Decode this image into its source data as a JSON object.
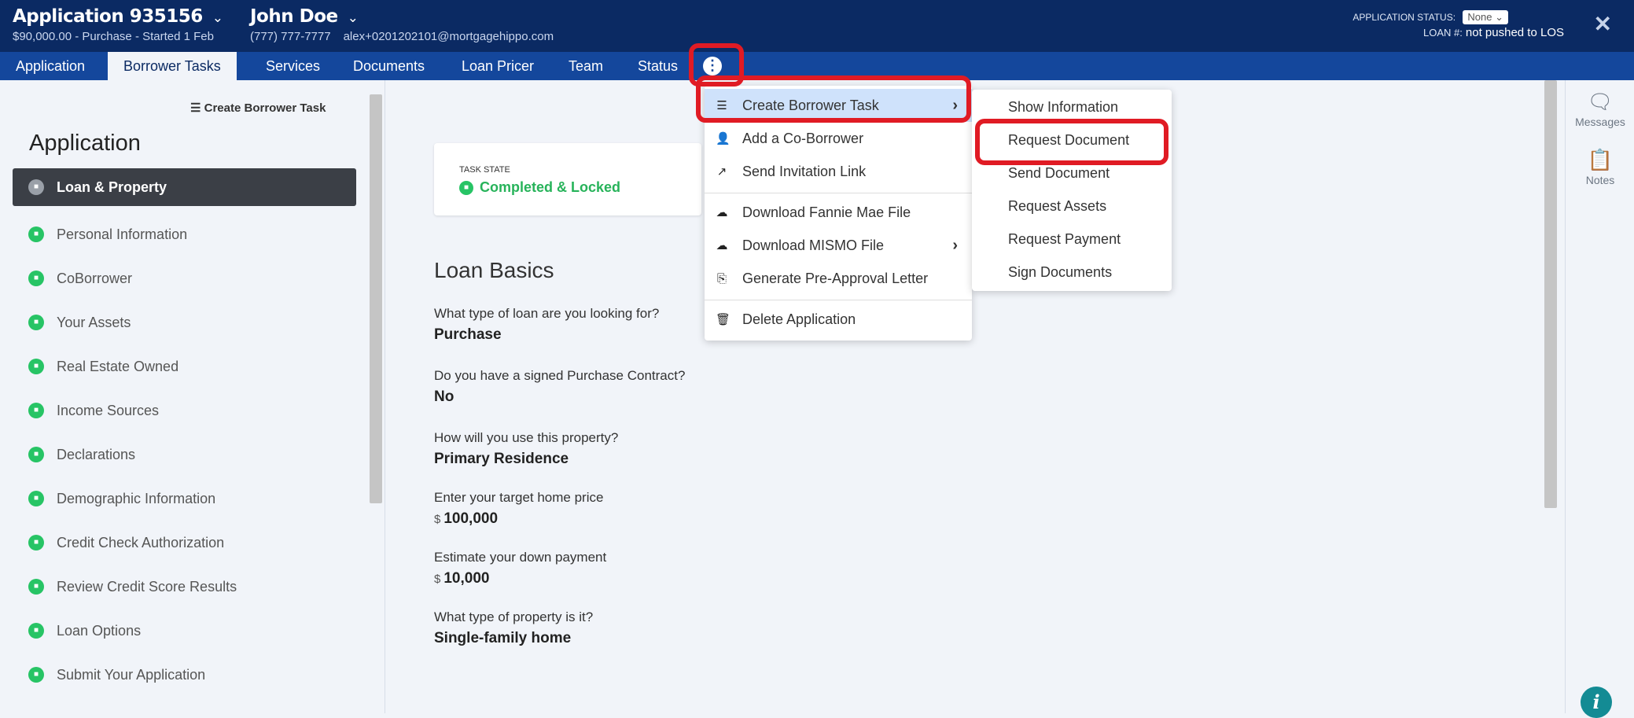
{
  "header": {
    "app_title": "Application 935156",
    "app_subtitle": "$90,000.00 - Purchase - Started 1 Feb",
    "person_name": "John Doe",
    "person_phone": "(777) 777-7777",
    "person_email": "alex+0201202101@mortgagehippo.com",
    "status_label": "APPLICATION STATUS:",
    "status_value": "None",
    "loan_label": "LOAN #:",
    "loan_value": "not pushed to LOS",
    "close_symbol": "✕",
    "chevron": "⌄"
  },
  "tabs": [
    {
      "label": "Application"
    },
    {
      "label": "Borrower Tasks"
    },
    {
      "label": "Services"
    },
    {
      "label": "Documents"
    },
    {
      "label": "Loan Pricer"
    },
    {
      "label": "Team"
    },
    {
      "label": "Status"
    }
  ],
  "more_button": "⋮",
  "sidebar": {
    "create_task_label": "Create Borrower Task",
    "title": "Application",
    "items": [
      {
        "label": "Loan & Property"
      },
      {
        "label": "Personal Information"
      },
      {
        "label": "CoBorrower"
      },
      {
        "label": "Your Assets"
      },
      {
        "label": "Real Estate Owned"
      },
      {
        "label": "Income Sources"
      },
      {
        "label": "Declarations"
      },
      {
        "label": "Demographic Information"
      },
      {
        "label": "Credit Check Authorization"
      },
      {
        "label": "Review Credit Score Results"
      },
      {
        "label": "Loan Options"
      },
      {
        "label": "Submit Your Application"
      }
    ]
  },
  "main": {
    "task_state_label": "TASK STATE",
    "task_state_value": "Completed & Locked",
    "section_title": "Loan Basics",
    "questions": [
      {
        "q": "What type of loan are you looking for?",
        "a": "Purchase",
        "currency": ""
      },
      {
        "q": "Do you have a signed Purchase Contract?",
        "a": "No",
        "currency": ""
      },
      {
        "q": "How will you use this property?",
        "a": "Primary Residence",
        "currency": ""
      },
      {
        "q": "Enter your target home price",
        "a": "100,000",
        "currency": "$"
      },
      {
        "q": "Estimate your down payment",
        "a": "10,000",
        "currency": "$"
      },
      {
        "q": "What type of property is it?",
        "a": "Single-family home",
        "currency": ""
      }
    ]
  },
  "right_panel": {
    "messages_label": "Messages",
    "notes_label": "Notes",
    "info_label": "i"
  },
  "menu": {
    "items": [
      {
        "label": "Create Borrower Task",
        "icon": "list-add-icon",
        "has_submenu": true
      },
      {
        "label": "Add a Co-Borrower",
        "icon": "add-user-icon"
      },
      {
        "label": "Send Invitation Link",
        "icon": "share-icon"
      },
      {
        "label": "Download Fannie Mae File",
        "icon": "cloud-download-icon"
      },
      {
        "label": "Download MISMO File",
        "icon": "cloud-download-icon",
        "has_submenu": true
      },
      {
        "label": "Generate Pre-Approval Letter",
        "icon": "document-export-icon"
      },
      {
        "label": "Delete Application",
        "icon": "trash-icon"
      }
    ],
    "submenu": [
      {
        "label": "Show Information"
      },
      {
        "label": "Request Document"
      },
      {
        "label": "Send Document"
      },
      {
        "label": "Request Assets"
      },
      {
        "label": "Request Payment"
      },
      {
        "label": "Sign Documents"
      }
    ]
  },
  "colors": {
    "header_bg": "#0b2a63",
    "tabbar_bg": "#14479c",
    "highlight": "#e01b24",
    "success": "#27c465",
    "selected_menu": "#cfe2fb"
  }
}
